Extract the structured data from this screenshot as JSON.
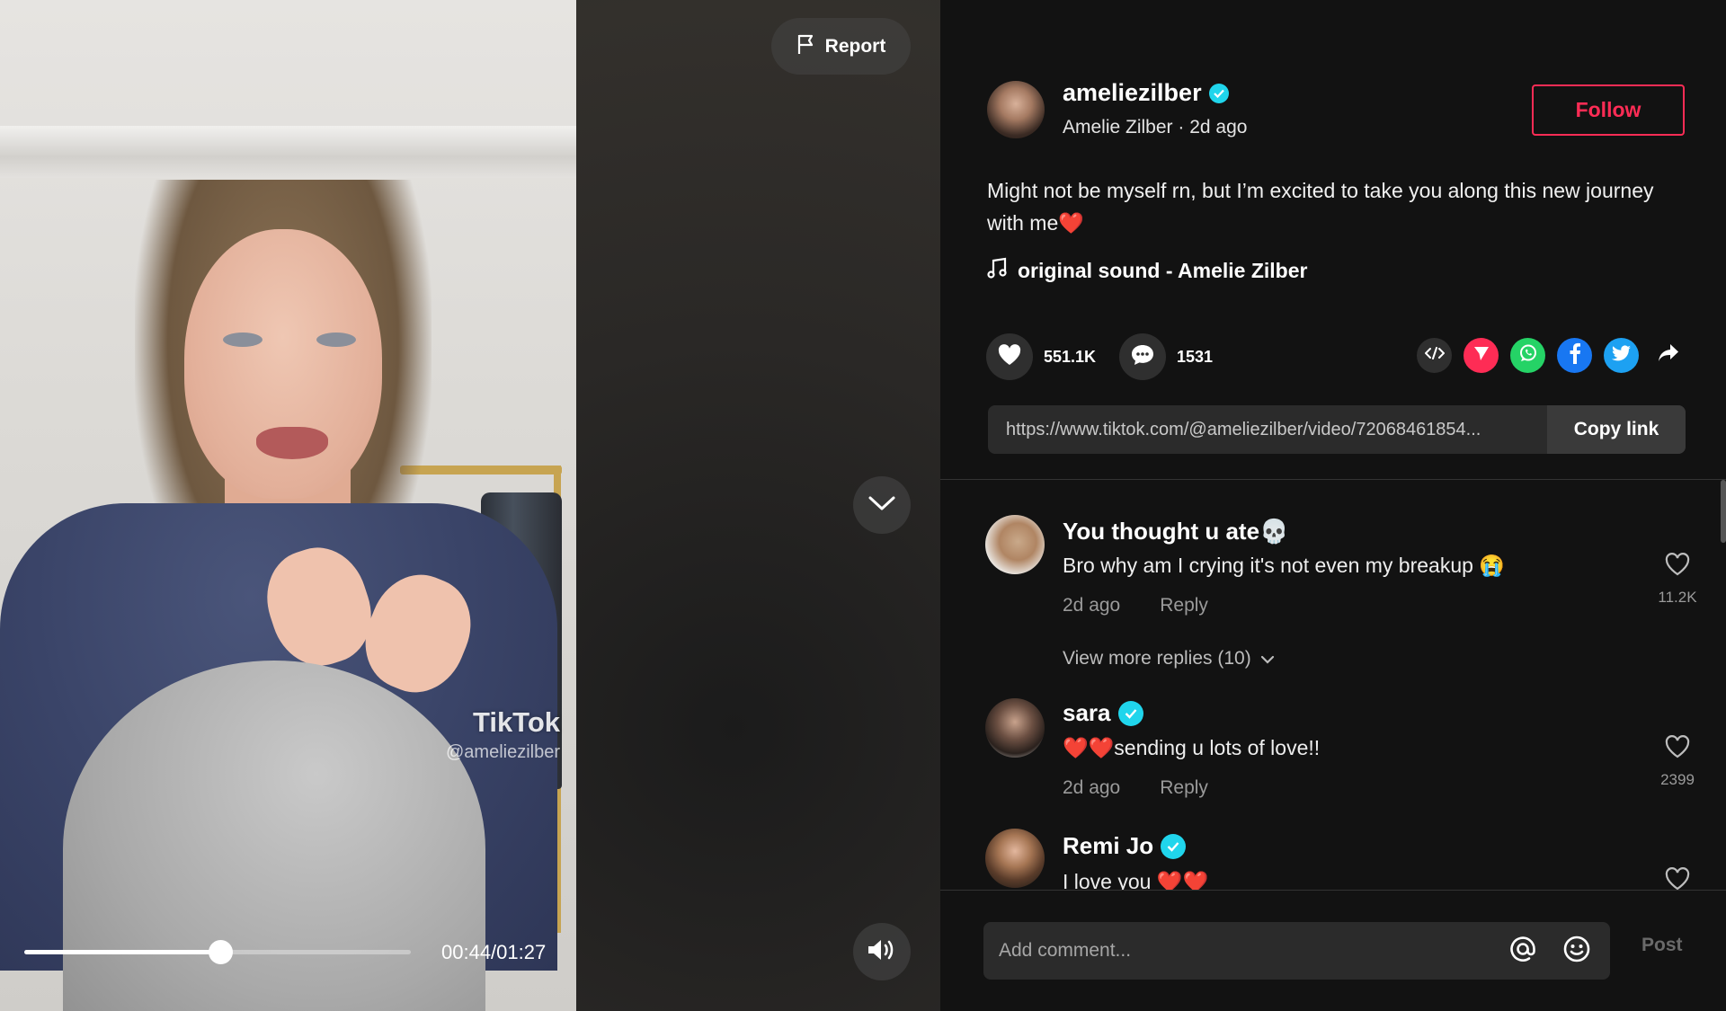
{
  "video": {
    "watermark_logo": "TikTok",
    "watermark_handle": "@ameliezilber",
    "current_time": "00:44",
    "duration": "01:27",
    "time_readout": "00:44/01:27",
    "progress_fraction": 0.506
  },
  "controls": {
    "report_label": "Report"
  },
  "author": {
    "handle": "ameliezilber",
    "meta": "Amelie Zilber · 2d ago",
    "follow_label": "Follow"
  },
  "post": {
    "caption": "Might not be myself rn, but I’m excited to take you along this new journey with me❤️",
    "sound": "original sound - Amelie Zilber",
    "likes": "551.1K",
    "comments_count": "1531"
  },
  "share": {
    "link": "https://www.tiktok.com/@ameliezilber/video/72068461854...",
    "copy_label": "Copy link"
  },
  "comments": [
    {
      "name": "You thought u ate💀",
      "text": "Bro why am I crying it's not even my breakup 😭",
      "time": "2d ago",
      "reply": "Reply",
      "likes": "11.2K",
      "verified": false
    },
    {
      "name": "sara",
      "text": "❤️❤️sending u lots of love!!",
      "time": "2d ago",
      "reply": "Reply",
      "likes": "2399",
      "verified": true
    },
    {
      "name": "Remi Jo",
      "text": "I love you ❤️❤️",
      "verified": true
    }
  ],
  "view_more": "View more replies (10)",
  "composer": {
    "placeholder": "Add comment...",
    "post_label": "Post"
  },
  "colors": {
    "accent": "#fe2c55",
    "verified": "#20d5ec",
    "panel_bg": "#121212"
  }
}
